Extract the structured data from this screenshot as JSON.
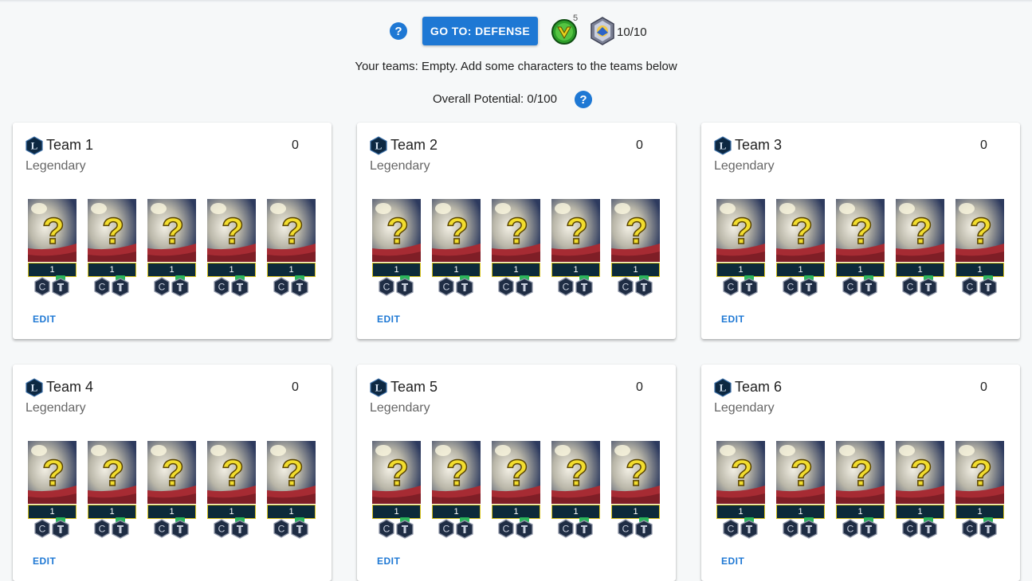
{
  "toolbar": {
    "help_symbol": "?",
    "goto_label": "GO TO: DEFENSE",
    "rank_count": "5",
    "league_count": "10/10"
  },
  "info_text": "Your teams: Empty. Add some characters to the teams below",
  "potential_text": "Overall Potential: 0/100",
  "potential_help_symbol": "?",
  "card_common": {
    "tier": "Legendary",
    "score": "0",
    "edit_label": "EDIT",
    "slot_level": "1"
  },
  "teams": [
    {
      "name": "Team 1",
      "score": "0",
      "tier": "Legendary",
      "levels": [
        "1",
        "1",
        "1",
        "1",
        "1"
      ],
      "edit": "EDIT"
    },
    {
      "name": "Team 2",
      "score": "0",
      "tier": "Legendary",
      "levels": [
        "1",
        "1",
        "1",
        "1",
        "1"
      ],
      "edit": "EDIT"
    },
    {
      "name": "Team 3",
      "score": "0",
      "tier": "Legendary",
      "levels": [
        "1",
        "1",
        "1",
        "1",
        "1"
      ],
      "edit": "EDIT"
    },
    {
      "name": "Team 4",
      "score": "0",
      "tier": "Legendary",
      "levels": [
        "1",
        "1",
        "1",
        "1",
        "1"
      ],
      "edit": "EDIT"
    },
    {
      "name": "Team 5",
      "score": "0",
      "tier": "Legendary",
      "levels": [
        "1",
        "1",
        "1",
        "1",
        "1"
      ],
      "edit": "EDIT"
    },
    {
      "name": "Team 6",
      "score": "0",
      "tier": "Legendary",
      "levels": [
        "1",
        "1",
        "1",
        "1",
        "1"
      ],
      "edit": "EDIT"
    }
  ],
  "icons": {
    "help": "question-circle-icon",
    "rank": "green-chevron-rank-icon",
    "league": "shield-league-icon",
    "team_league": "legendary-l-hex-icon",
    "portrait": "unknown-character-portrait",
    "gear": "gear-tier-c-icon",
    "relic": "relic-tier-icon"
  },
  "colors": {
    "accent": "#1e78d4",
    "page_bg": "#f6f8f9",
    "level_bar": "#0c2a3a",
    "level_border": "#d8c21e",
    "question_mark": "#f2dd2e"
  }
}
